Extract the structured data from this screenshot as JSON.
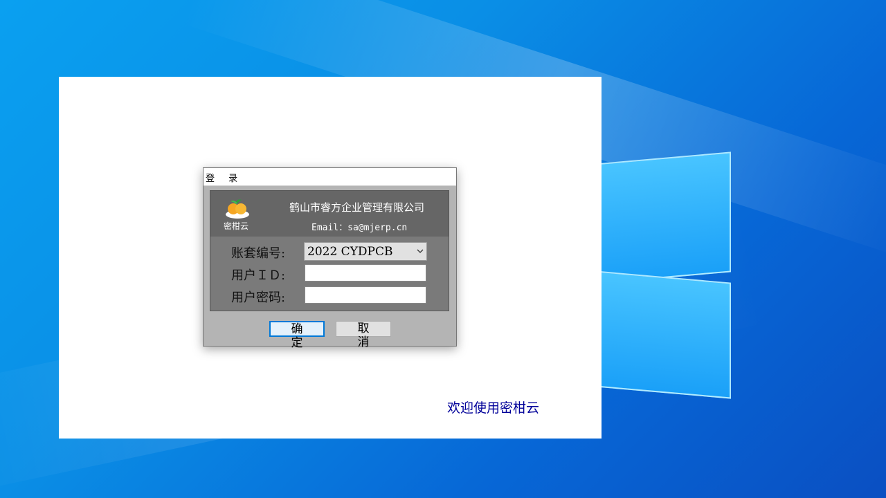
{
  "dialog": {
    "title": "登 录",
    "company": "鹤山市睿方企业管理有限公司",
    "email": "Email：sa@mjerp.cn",
    "logo_text": "密柑云",
    "fields": {
      "account_label": "账套编号:",
      "account_value": "2022 CYDPCB",
      "user_id_label": "用户ＩＤ:",
      "user_id_value": "",
      "password_label": "用户密码:",
      "password_value": ""
    },
    "buttons": {
      "ok": "确定",
      "cancel": "取消"
    }
  },
  "splash": {
    "welcome": "欢迎使用密柑云"
  },
  "colors": {
    "accent": "#0078d7",
    "welcome_text": "#000099",
    "panel": "#7a7a7a",
    "header": "#666666"
  },
  "icons": {
    "logo": "orange-fruit-logo",
    "dropdown": "chevron-down-icon"
  }
}
